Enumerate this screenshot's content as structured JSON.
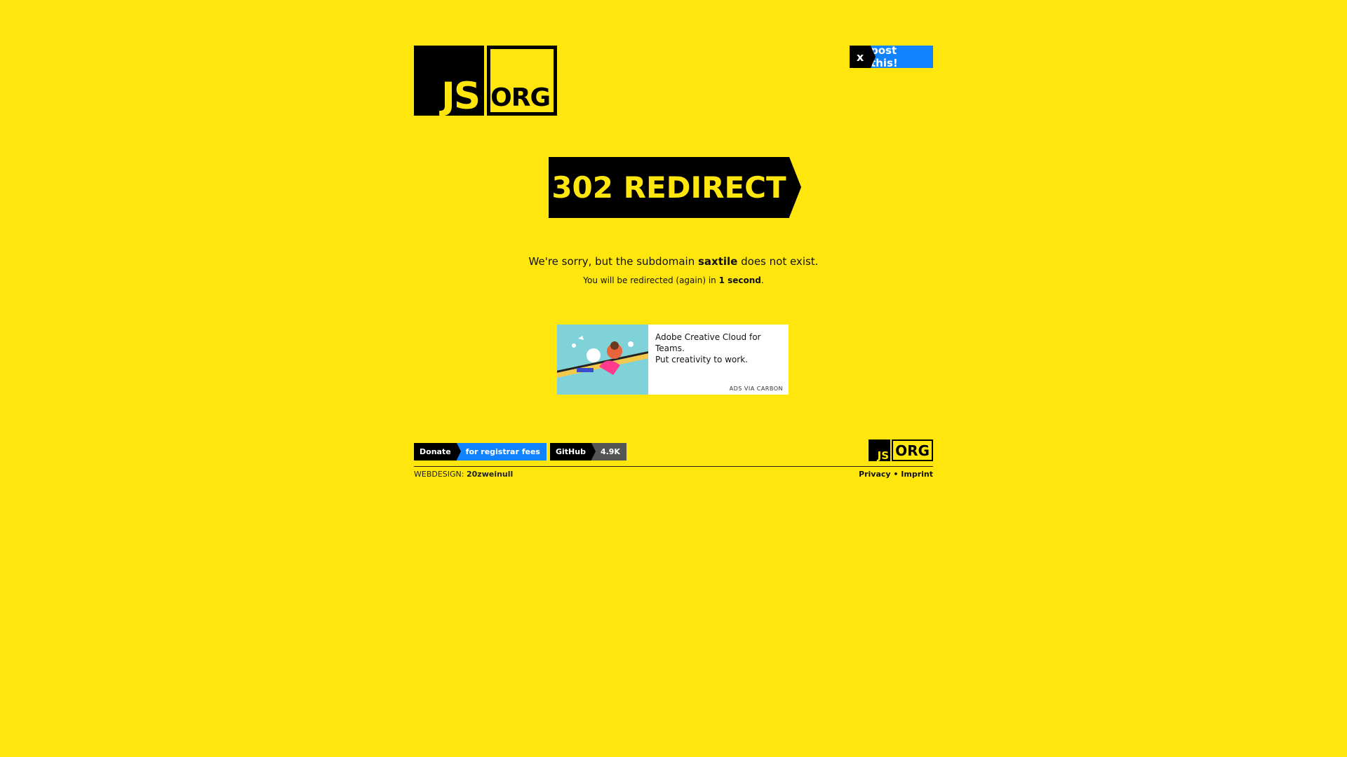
{
  "header": {
    "logo_js": "JS",
    "logo_org": "ORG",
    "post_icon": "x-icon",
    "post_icon_text": "x",
    "post_label": "post this!"
  },
  "main": {
    "title": "302 REDIRECT",
    "message_prefix": "We're sorry, but the subdomain ",
    "subdomain": "saxtile",
    "message_suffix": " does not exist.",
    "redirect_prefix": "You will be redirected (again) in ",
    "redirect_time": "1 second",
    "redirect_suffix": "."
  },
  "ad": {
    "line1": "Adobe Creative Cloud for Teams.",
    "line2": "Put creativity to work.",
    "via": "ADS VIA CARBON"
  },
  "footer": {
    "donate_left": "Donate",
    "donate_right": "for registrar fees",
    "github_left": "GitHub",
    "github_right": "4.9K",
    "logo_js": "JS",
    "logo_org": "ORG",
    "webdesign_label": "WEBDESIGN: ",
    "webdesign_name": "20zweinull",
    "privacy": "Privacy",
    "separator": " • ",
    "imprint": "Imprint"
  },
  "colors": {
    "background": "#ffe70e",
    "accent_blue": "#1183ff",
    "black": "#000000"
  }
}
